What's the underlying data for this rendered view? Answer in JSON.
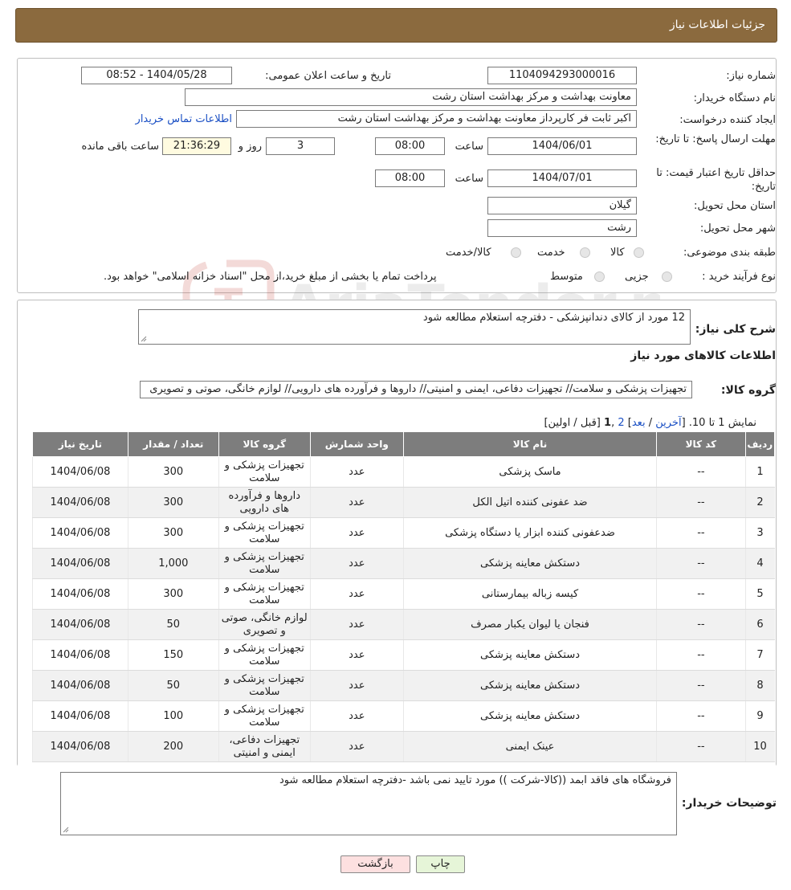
{
  "header": {
    "title": "جزئیات اطلاعات نیاز"
  },
  "form": {
    "need_number_label": "شماره نیاز:",
    "need_number": "1104094293000016",
    "announce_label": "تاریخ و ساعت اعلان عمومی:",
    "announce_value": "1404/05/28 - 08:52",
    "buyer_org_label": "نام دستگاه خریدار:",
    "buyer_org": "معاونت بهداشت و مرکز بهداشت استان رشت",
    "creator_label": "ایجاد کننده درخواست:",
    "creator": "اکبر ثابت فر کارپرداز معاونت بهداشت و مرکز بهداشت استان رشت",
    "contact_link": "اطلاعات تماس خریدار",
    "deadline_label": "مهلت ارسال پاسخ: تا تاریخ:",
    "deadline_date": "1404/06/01",
    "time_label": "ساعت",
    "deadline_time": "08:00",
    "days_value": "3",
    "days_label": "روز و",
    "remaining_time": "21:36:29",
    "remaining_label": "ساعت باقی مانده",
    "validity_label": "حداقل تاریخ اعتبار قیمت: تا تاریخ:",
    "validity_date": "1404/07/01",
    "validity_time": "08:00",
    "province_label": "استان محل تحویل:",
    "province": "گیلان",
    "city_label": "شهر محل تحویل:",
    "city": "رشت",
    "category_label": "طبقه بندی موضوعی:",
    "category_options": [
      "کالا",
      "خدمت",
      "کالا/خدمت"
    ],
    "process_label": "نوع فرآیند خرید :",
    "process_options": [
      "جزیی",
      "متوسط"
    ],
    "process_note": "پرداخت تمام یا بخشی از مبلغ خرید،از محل \"اسناد خزانه اسلامی\" خواهد بود."
  },
  "summary": {
    "desc_label": "شرح کلی نیاز:",
    "desc_value": "12  مورد از  کالای  دندانپزشکی - دفترچه استعلام مطالعه شود",
    "items_heading": "اطلاعات کالاهای مورد نیاز",
    "group_label": "گروه کالا:",
    "group_value": "تجهیزات پزشکی و سلامت// تجهیزات دفاعی، ایمنی و امنیتی// داروها و فرآورده های دارویی// لوازم خانگی، صوتی و تصویری",
    "paging_prefix": "نمایش 1 تا 10. [",
    "paging_last": "آخرین",
    "paging_next": "بعد",
    "paging_2": "2",
    "paging_1": "1",
    "paging_suffix": "[قبل / اولین]"
  },
  "table": {
    "headers": [
      "ردیف",
      "کد کالا",
      "نام کالا",
      "واحد شمارش",
      "گروه کالا",
      "تعداد / مقدار",
      "تاریخ نیاز"
    ],
    "rows": [
      [
        "1",
        "--",
        "ماسک پزشکی",
        "عدد",
        "تجهیزات پزشکی و سلامت",
        "300",
        "1404/06/08"
      ],
      [
        "2",
        "--",
        "ضد عفونی کننده اتیل الکل",
        "عدد",
        "داروها و فرآورده های دارویی",
        "300",
        "1404/06/08"
      ],
      [
        "3",
        "--",
        "ضدعفونی کننده ابزار یا دستگاه پزشکی",
        "عدد",
        "تجهیزات پزشکی و سلامت",
        "300",
        "1404/06/08"
      ],
      [
        "4",
        "--",
        "دستکش معاینه پزشکی",
        "عدد",
        "تجهیزات پزشکی و سلامت",
        "1,000",
        "1404/06/08"
      ],
      [
        "5",
        "--",
        "کیسه زباله بیمارستانی",
        "عدد",
        "تجهیزات پزشکی و سلامت",
        "300",
        "1404/06/08"
      ],
      [
        "6",
        "--",
        "فنجان یا لیوان یکبار مصرف",
        "عدد",
        "لوازم خانگی، صوتی و تصویری",
        "50",
        "1404/06/08"
      ],
      [
        "7",
        "--",
        "دستکش معاینه پزشکی",
        "عدد",
        "تجهیزات پزشکی و سلامت",
        "150",
        "1404/06/08"
      ],
      [
        "8",
        "--",
        "دستکش معاینه پزشکی",
        "عدد",
        "تجهیزات پزشکی و سلامت",
        "50",
        "1404/06/08"
      ],
      [
        "9",
        "--",
        "دستکش معاینه پزشکی",
        "عدد",
        "تجهیزات پزشکی و سلامت",
        "100",
        "1404/06/08"
      ],
      [
        "10",
        "--",
        "عینک ایمنی",
        "عدد",
        "تجهیزات دفاعی، ایمنی و امنیتی",
        "200",
        "1404/06/08"
      ]
    ]
  },
  "buyer_notes": {
    "label": "توضیحات خریدار:",
    "value": "فروشگاه های فاقد ابمد ((کالا-شرکت )) مورد تایید نمی باشد -دفترچه استعلام مطالعه شود"
  },
  "buttons": {
    "print": "چاپ",
    "back": "بازگشت"
  },
  "watermark": {
    "text": "AriaTender.neT"
  },
  "colors": {
    "header_bg": "#8b6a3e",
    "table_header_bg": "#7d7d7d",
    "link": "#1a4fc4",
    "back_button_bg": "#fde0e0",
    "print_button_bg": "#e6f5d8"
  }
}
